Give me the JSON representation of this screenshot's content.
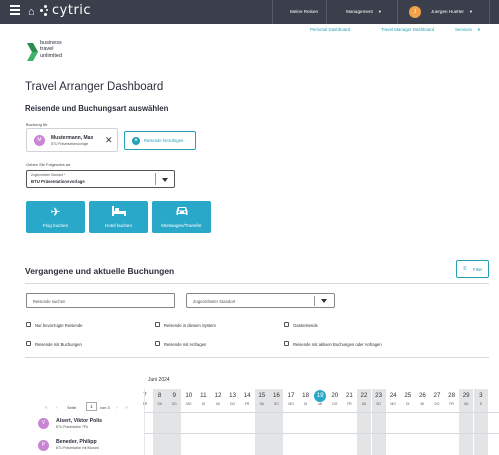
{
  "topbar": {
    "brand": "cytric",
    "nav": [
      "Meine Reisen",
      "Management",
      "Juergen Huetter"
    ],
    "avatar_initial": "J"
  },
  "subnav": [
    "Personal Dashboard",
    "Travel Manager Dashboard",
    "Services"
  ],
  "logo": {
    "line1": "business",
    "line2": "travel",
    "line3": "unlimited"
  },
  "page_title": "Travel Arranger Dashboard",
  "section1": {
    "title": "Reisende und Buchungsart auswählen",
    "booking_for_label": "Buchung für",
    "traveller": {
      "initial": "M",
      "name": "Mustermann, Max",
      "sub": "BTU Präsentationsvorlage"
    },
    "add_traveller": "Reisende hinzufügen",
    "instruction": "Geben Sie Folgendes an:",
    "location_caption": "Zugeordneter Standort *",
    "location_value": "BTU Präsentationsvorlage",
    "tiles": [
      "Flug buchen",
      "Hotel buchen",
      "Mietwagen/Transfer"
    ]
  },
  "section2": {
    "title": "Vergangene und aktuelle Buchungen",
    "filter": "Filter",
    "search_placeholder": "Reisende suchen",
    "location_placeholder": "Zugeordneter Standort",
    "checkboxes": [
      "Nur bevorzugte Reisende",
      "Reisende in diesem System",
      "Gastreisende",
      "Reisende mit Buchungen",
      "Reisende mit Anfragen",
      "Reisende mit aktiven Buchungen oder Anfragen"
    ]
  },
  "calendar": {
    "month": "Juni 2024",
    "pager": {
      "label": "Seite",
      "page": "1",
      "of": "von 3"
    },
    "days": [
      {
        "n": "7",
        "w": "FR",
        "we": false
      },
      {
        "n": "8",
        "w": "SA",
        "we": true
      },
      {
        "n": "9",
        "w": "SO",
        "we": true
      },
      {
        "n": "10",
        "w": "MO",
        "we": false
      },
      {
        "n": "11",
        "w": "DI",
        "we": false
      },
      {
        "n": "12",
        "w": "MI",
        "we": false
      },
      {
        "n": "13",
        "w": "DO",
        "we": false
      },
      {
        "n": "14",
        "w": "FR",
        "we": false
      },
      {
        "n": "15",
        "w": "SA",
        "we": true
      },
      {
        "n": "16",
        "w": "SO",
        "we": true
      },
      {
        "n": "17",
        "w": "MO",
        "we": false
      },
      {
        "n": "18",
        "w": "DI",
        "we": false
      },
      {
        "n": "19",
        "w": "MI",
        "we": false,
        "today": true
      },
      {
        "n": "20",
        "w": "DO",
        "we": false
      },
      {
        "n": "21",
        "w": "FR",
        "we": false
      },
      {
        "n": "22",
        "w": "SA",
        "we": true
      },
      {
        "n": "23",
        "w": "SO",
        "we": true
      },
      {
        "n": "24",
        "w": "MO",
        "we": false
      },
      {
        "n": "25",
        "w": "DI",
        "we": false
      },
      {
        "n": "26",
        "w": "MI",
        "we": false
      },
      {
        "n": "27",
        "w": "DO",
        "we": false
      },
      {
        "n": "28",
        "w": "FR",
        "we": false
      },
      {
        "n": "29",
        "w": "SA",
        "we": true
      },
      {
        "n": "3",
        "w": "S",
        "we": true
      }
    ],
    "rows": [
      {
        "initial": "V",
        "name": "Alsert, Viktor Polis",
        "sub": "BTU Präsentation TPA"
      },
      {
        "initial": "P",
        "name": "Beneder, Philipp",
        "sub": "BTU Präsentation mit Wizzard"
      }
    ]
  },
  "colors": {
    "accent": "#2aa8c9",
    "topbar": "#3a3f4b",
    "avatar": "#c985d3"
  }
}
